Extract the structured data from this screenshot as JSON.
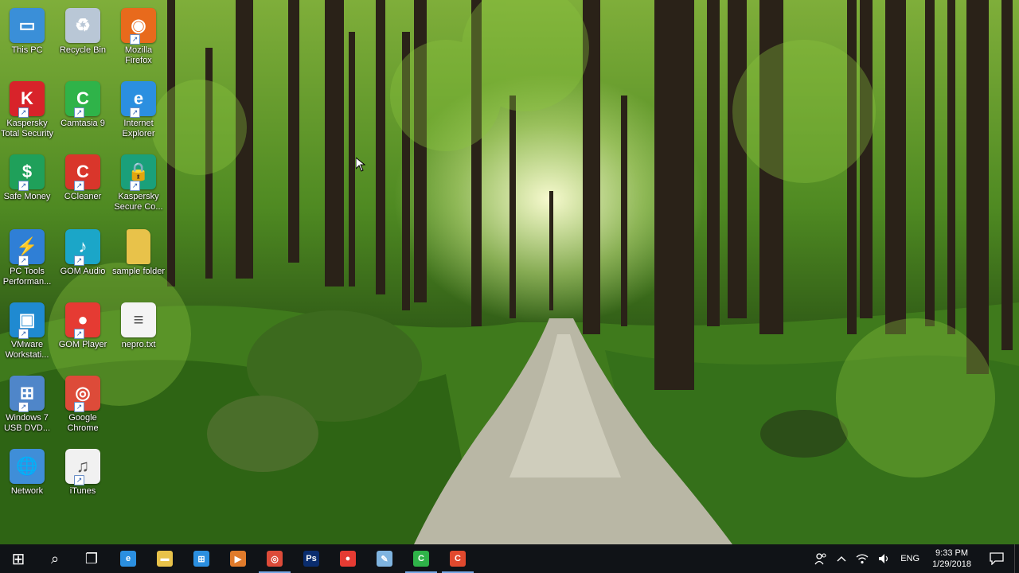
{
  "desktop": {
    "icons": [
      {
        "label": "This PC",
        "icon": "this-pc-icon",
        "color": "#3a8fd8",
        "glyph": "▭"
      },
      {
        "label": "Recycle Bin",
        "icon": "recycle-bin-icon",
        "color": "#b9c7d6",
        "glyph": "♻"
      },
      {
        "label": "Mozilla Firefox",
        "icon": "firefox-icon",
        "color": "#e86a1c",
        "glyph": "◉"
      },
      {
        "label": "Kaspersky Total Security",
        "icon": "kaspersky-icon",
        "color": "#d8232a",
        "glyph": "K"
      },
      {
        "label": "Camtasia 9",
        "icon": "camtasia-icon",
        "color": "#2fb349",
        "glyph": "C"
      },
      {
        "label": "Internet Explorer",
        "icon": "internet-explorer-icon",
        "color": "#2b8fe0",
        "glyph": "e"
      },
      {
        "label": "Safe Money",
        "icon": "safe-money-icon",
        "color": "#1fa05a",
        "glyph": "$"
      },
      {
        "label": "CCleaner",
        "icon": "ccleaner-icon",
        "color": "#d9362b",
        "glyph": "C"
      },
      {
        "label": "Kaspersky Secure Co...",
        "icon": "kaspersky-secure-connection-icon",
        "color": "#1aa07a",
        "glyph": "🔒"
      },
      {
        "label": "PC Tools Performan...",
        "icon": "pc-tools-icon",
        "color": "#2f7fd6",
        "glyph": "⚡"
      },
      {
        "label": "GOM Audio",
        "icon": "gom-audio-icon",
        "color": "#1ba6c8",
        "glyph": "♪"
      },
      {
        "label": "sample folder",
        "icon": "folder-icon",
        "color": "#e8c24a",
        "glyph": ""
      },
      {
        "label": "VMware Workstati...",
        "icon": "vmware-icon",
        "color": "#1f8ad1",
        "glyph": "▣"
      },
      {
        "label": "GOM Player",
        "icon": "gom-player-icon",
        "color": "#e53b33",
        "glyph": "●"
      },
      {
        "label": "nepro.txt",
        "icon": "text-file-icon",
        "color": "#f4f4f4",
        "glyph": "≡"
      },
      {
        "label": "Windows 7 USB DVD...",
        "icon": "windows-usb-dvd-tool-icon",
        "color": "#4f86c9",
        "glyph": "⊞"
      },
      {
        "label": "Google Chrome",
        "icon": "chrome-icon",
        "color": "#dd4b39",
        "glyph": "◎"
      },
      {
        "label": "Network",
        "icon": "network-icon",
        "color": "#3f8ed8",
        "glyph": "🌐"
      },
      {
        "label": "iTunes",
        "icon": "itunes-icon",
        "color": "#f1f1f1",
        "glyph": "♫"
      }
    ]
  },
  "taskbar": {
    "buttons": [
      {
        "name": "start-button",
        "icon": "windows-logo-icon",
        "color": "#ffffff",
        "glyph": "⊞",
        "active": false
      },
      {
        "name": "search-button",
        "icon": "search-icon",
        "color": "#ffffff",
        "glyph": "⌕",
        "active": false
      },
      {
        "name": "task-view-button",
        "icon": "task-view-icon",
        "color": "#ffffff",
        "glyph": "❐",
        "active": false
      },
      {
        "name": "taskbar-edge",
        "icon": "edge-icon",
        "color": "#2b8fe0",
        "glyph": "e",
        "active": false
      },
      {
        "name": "taskbar-file-explorer",
        "icon": "file-explorer-icon",
        "color": "#e8c24a",
        "glyph": "▬",
        "active": false
      },
      {
        "name": "taskbar-store",
        "icon": "store-icon",
        "color": "#2b8fe0",
        "glyph": "⊞",
        "active": false
      },
      {
        "name": "taskbar-media",
        "icon": "media-player-icon",
        "color": "#e07b2b",
        "glyph": "▶",
        "active": false
      },
      {
        "name": "taskbar-chrome",
        "icon": "chrome-icon",
        "color": "#dd4b39",
        "glyph": "◎",
        "active": true
      },
      {
        "name": "taskbar-photoshop",
        "icon": "photoshop-icon",
        "color": "#0a2d6e",
        "glyph": "Ps",
        "active": false
      },
      {
        "name": "taskbar-gom-player",
        "icon": "gom-player-icon",
        "color": "#e53b33",
        "glyph": "●",
        "active": false
      },
      {
        "name": "taskbar-notepad",
        "icon": "notepad-icon",
        "color": "#7fb4e0",
        "glyph": "✎",
        "active": false
      },
      {
        "name": "taskbar-camtasia",
        "icon": "camtasia-icon",
        "color": "#2fb349",
        "glyph": "C",
        "active": true
      },
      {
        "name": "taskbar-camtasia-recorder",
        "icon": "camtasia-recorder-icon",
        "color": "#e0492e",
        "glyph": "C",
        "active": true
      }
    ],
    "tray": {
      "people_icon": "people-icon",
      "chevron_icon": "chevron-up-icon",
      "network_icon": "wifi-icon",
      "volume_icon": "volume-icon",
      "language": "ENG",
      "time": "9:33 PM",
      "date": "1/29/2018",
      "notification_icon": "action-center-icon"
    }
  }
}
